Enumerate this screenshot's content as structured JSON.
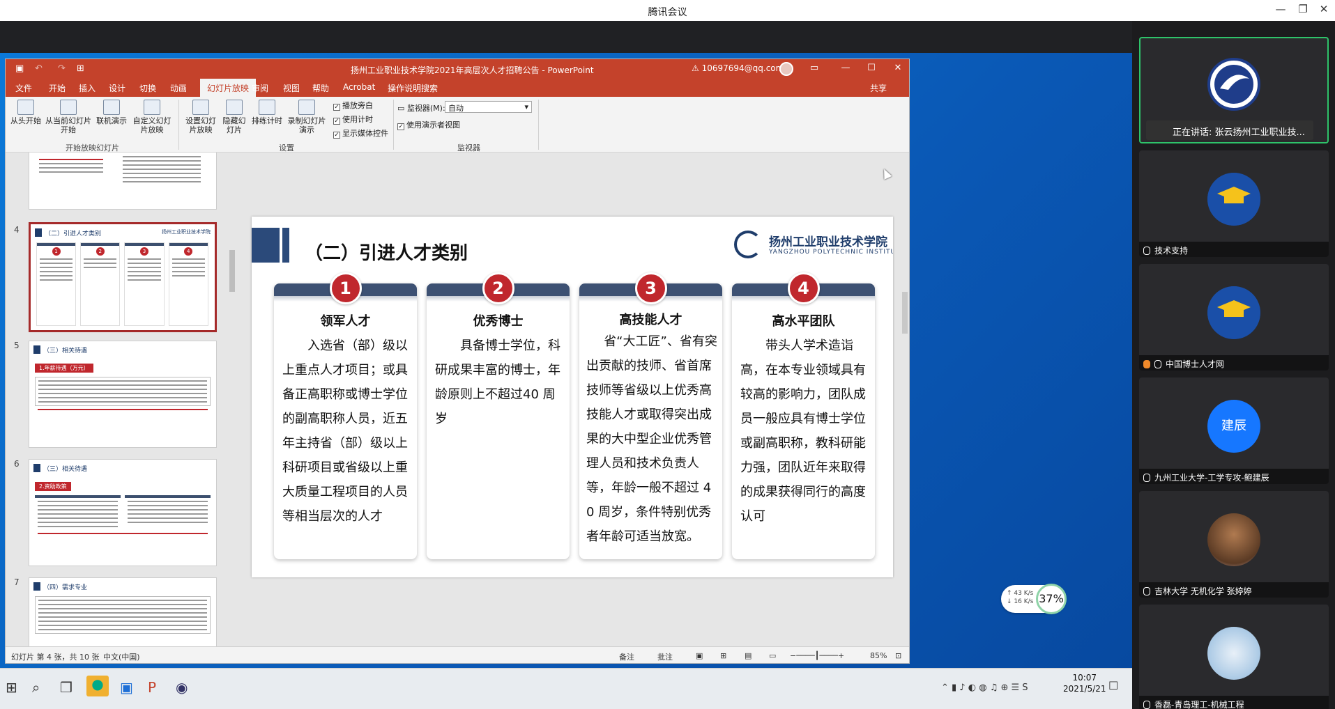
{
  "meeting": {
    "title": "腾讯会议",
    "min": "—",
    "max": "❐",
    "close": "✕"
  },
  "ppt": {
    "title": "扬州工业职业技术学院2021年高层次人才招聘公告 - PowerPoint",
    "account": "⚠ 10697694@qq.com",
    "tabs": [
      "文件",
      "开始",
      "插入",
      "设计",
      "切换",
      "动画",
      "幻灯片放映",
      "审阅",
      "视图",
      "帮助",
      "Acrobat",
      "操作说明搜索"
    ],
    "share": "共享",
    "ribbon": {
      "btn_from_start": "从头开始",
      "btn_from_current": "从当前幻灯片开始",
      "btn_online": "联机演示",
      "btn_custom": "自定义幻灯片放映",
      "grp_start": "开始放映幻灯片",
      "btn_setup": "设置幻灯片放映",
      "btn_hide": "隐藏幻灯片",
      "btn_rehearse": "排练计时",
      "btn_record": "录制幻灯片演示",
      "cb_narration": "播放旁白",
      "cb_timing": "使用计时",
      "cb_media": "显示媒体控件",
      "grp_setup": "设置",
      "monitor_label": "监视器(M):",
      "monitor_value": "自动",
      "cb_presenter": "使用演示者视图",
      "grp_monitor": "监视器"
    },
    "thumb_numbers": [
      "4",
      "5",
      "6",
      "7"
    ],
    "thumbs": {
      "t4_title": "（二）引进人才类别",
      "t5_title": "（三）相关待遇",
      "t5_red": "1.年薪待遇（万元）",
      "t6_title": "（三）相关待遇",
      "t6_red": "2.资助政策",
      "t7_title": "（四）需求专业"
    },
    "slide": {
      "title": "（二）引进人才类别",
      "logo_cn": "扬州工业职业技术学院",
      "logo_en": "YANGZHOU POLYTECHNIC INSTITUTE",
      "cards": [
        {
          "num": "1",
          "title": "领军人才",
          "body": "入选省（部）级以上重点人才项目；或具备正高职称或博士学位的副高职称人员，近五年主持省（部）级以上科研项目或省级以上重大质量工程项目的人员等相当层次的人才"
        },
        {
          "num": "2",
          "title": "优秀博士",
          "body": "具备博士学位，科研成果丰富的博士，年龄原则上不超过40 周岁"
        },
        {
          "num": "3",
          "title": "高技能人才",
          "body": "省“大工匠”、省有突出贡献的技师、省首席技师等省级以上优秀高技能人才或取得突出成果的大中型企业优秀管理人员和技术负责人等，年龄一般不超过 40 周岁，条件特别优秀者年龄可适当放宽。"
        },
        {
          "num": "4",
          "title": "高水平团队",
          "body": "带头人学术造诣高，在本专业领域具有较高的影响力，团队成员一般应具有博士学位或副高职称，教科研能力强，团队近年来取得的成果获得同行的高度认可"
        }
      ]
    },
    "status": {
      "slide_info": "幻灯片 第 4 张，共 10 张",
      "lang": "中文(中国)",
      "notes": "备注",
      "comments": "批注",
      "zoom": "85%"
    }
  },
  "taskbar": {
    "time": "10:07",
    "date": "2021/5/21"
  },
  "network": {
    "up": "↑ 43 K/s",
    "down": "↓ 16 K/s",
    "cpu": "37%"
  },
  "participants": {
    "speaking": "正在讲话: 张云扬州工业职业技...",
    "names": [
      "技术支持",
      "中国博士人才网",
      "九州工业大学-工学专攻-鲍建辰",
      "吉林大学  无机化学  张婷婷",
      "香磊-青岛理工-机械工程"
    ],
    "avatar_text": "建辰"
  }
}
